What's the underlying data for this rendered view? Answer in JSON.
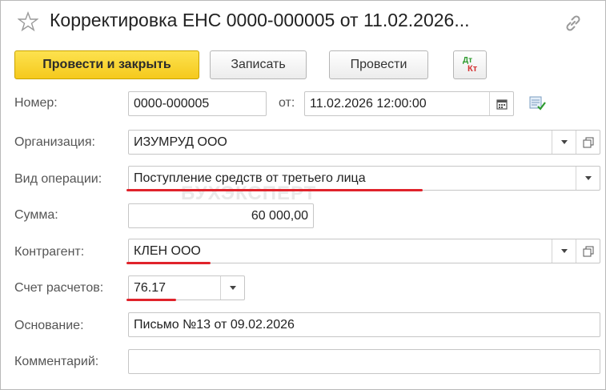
{
  "window": {
    "title": "Корректировка ЕНС 0000-000005 от 11.02.2026..."
  },
  "toolbar": {
    "post_close_label": "Провести и закрыть",
    "save_label": "Записать",
    "post_label": "Провести",
    "dt_label": "Дт",
    "kt_label": "Кт"
  },
  "form": {
    "number": {
      "label": "Номер:",
      "value": "0000-000005"
    },
    "date": {
      "label": "от:",
      "value": "11.02.2026 12:00:00"
    },
    "organization": {
      "label": "Организация:",
      "value": "ИЗУМРУД ООО"
    },
    "operation_type": {
      "label": "Вид операции:",
      "value": "Поступление средств от третьего лица"
    },
    "amount": {
      "label": "Сумма:",
      "value": "60 000,00"
    },
    "counterparty": {
      "label": "Контрагент:",
      "value": "КЛЕН ООО"
    },
    "account": {
      "label": "Счет расчетов:",
      "value": "76.17"
    },
    "basis": {
      "label": "Основание:",
      "value": "Письмо №13 от 09.02.2026"
    },
    "comment": {
      "label": "Комментарий:",
      "value": ""
    }
  },
  "watermark": "БУХЭКСПЕРТ",
  "colors": {
    "primary_button": "#f5c91d",
    "highlight_underline": "#e0232b",
    "dt": "#2e9b2e",
    "kt": "#d43030"
  }
}
